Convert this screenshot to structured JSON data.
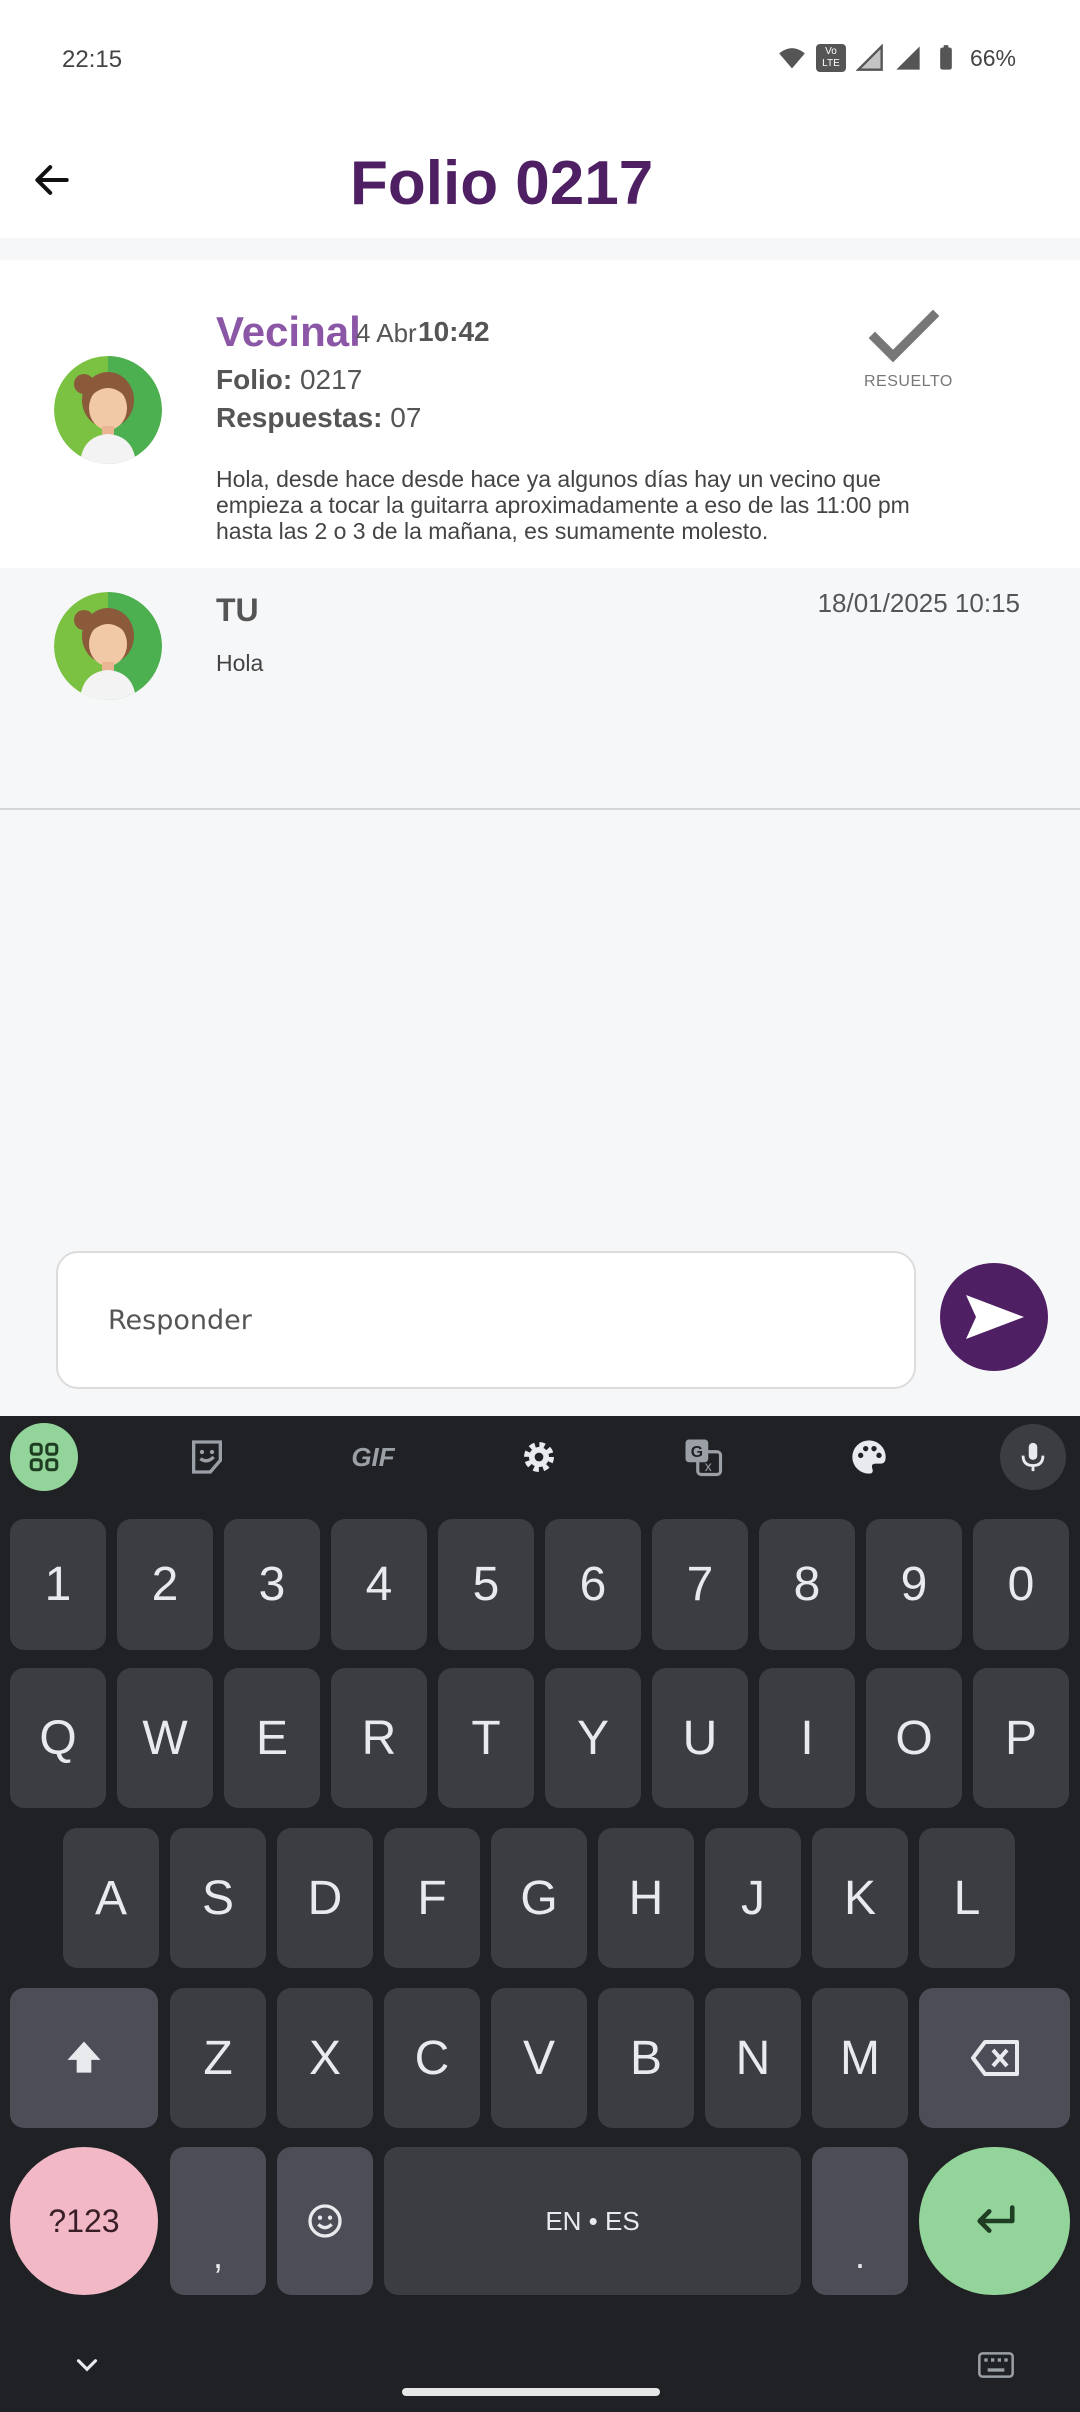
{
  "status_bar": {
    "time": "22:15",
    "battery": "66%",
    "wifi_icon": "wifi-icon",
    "volte_label": "Vo LTE",
    "signal_icon": "signal-icon",
    "battery_icon": "battery-icon"
  },
  "app_bar": {
    "title": "Folio 0217",
    "back_icon": "arrow-left-icon"
  },
  "post": {
    "author": "Vecinal",
    "date": "4 Abr",
    "time": "10:42",
    "folio_label": "Folio:",
    "folio_value": "0217",
    "responses_label": "Respuestas:",
    "responses_value": "07",
    "status_label": "RESUELTO",
    "body": "Hola, desde hace desde hace ya algunos días hay un vecino que empieza a tocar la guitarra aproximadamente a eso de las 11:00 pm hasta las 2 o 3 de la mañana, es sumamente molesto."
  },
  "reply": {
    "author": "TU",
    "datetime": "18/01/2025 10:15",
    "text": "Hola"
  },
  "composer": {
    "placeholder": "Responder",
    "send_icon": "send-icon"
  },
  "keyboard": {
    "toolbar": [
      "apps-grid-icon",
      "sticker-icon",
      "gif-icon",
      "settings-icon",
      "translate-icon",
      "palette-icon",
      "mic-icon"
    ],
    "gif_label": "GIF",
    "row_numbers": [
      "1",
      "2",
      "3",
      "4",
      "5",
      "6",
      "7",
      "8",
      "9",
      "0"
    ],
    "row1": [
      "Q",
      "W",
      "E",
      "R",
      "T",
      "Y",
      "U",
      "I",
      "O",
      "P"
    ],
    "row2": [
      "A",
      "S",
      "D",
      "F",
      "G",
      "H",
      "J",
      "K",
      "L"
    ],
    "row3": [
      "Z",
      "X",
      "C",
      "V",
      "B",
      "N",
      "M"
    ],
    "symbols_label": "?123",
    "comma": ",",
    "period": ".",
    "space_label": "EN • ES"
  },
  "colors": {
    "primary": "#4f1f63",
    "author": "#8a56a5",
    "keyboard_bg": "#202124",
    "key_bg": "#3c3d41",
    "enter_key": "#93d49a",
    "symbols_key": "#f2b8c6"
  }
}
